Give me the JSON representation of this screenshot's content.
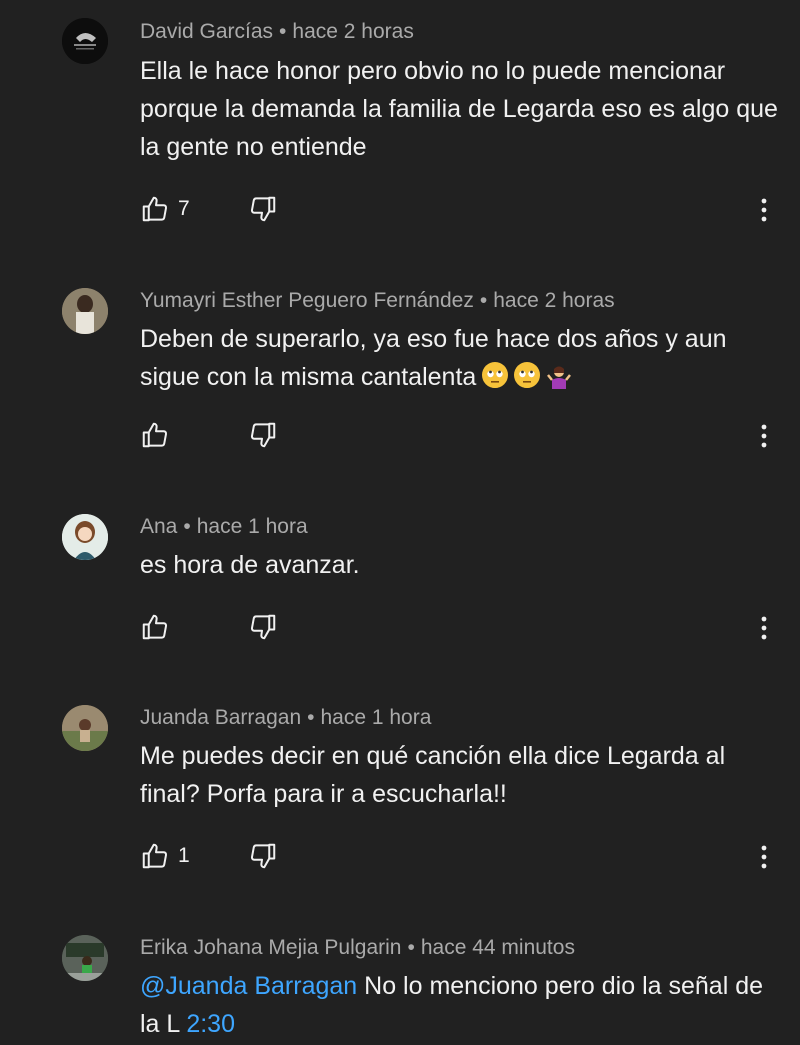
{
  "comments": [
    {
      "author": "David Garcías",
      "time": "hace 2 horas",
      "text": "Ella le hace honor pero obvio no lo puede mencionar porque la demanda la familia de Legarda eso es algo que la gente no entiende",
      "likes": "7",
      "avatar_color": "#111111"
    },
    {
      "author": "Yumayri Esther Peguero Fernández",
      "time": "hace 2 horas",
      "text": "Deben de superarlo, ya eso fue hace dos años y aun sigue con la misma cantalenta",
      "emojis": [
        "face-with-rolling-eyes",
        "face-with-rolling-eyes",
        "person-shrugging"
      ],
      "likes": "",
      "avatar_color": "#6b5c4a"
    },
    {
      "author": "Ana",
      "time": "hace 1 hora",
      "text": "es hora de avanzar.",
      "likes": "",
      "avatar_color": "#5d8a7a"
    },
    {
      "author": "Juanda Barragan",
      "time": "hace 1 hora",
      "text": "Me puedes decir en qué canción ella dice Legarda al final? Porfa para ir a escucharla!!",
      "likes": "1",
      "avatar_color": "#7a6a55"
    },
    {
      "author": "Erika Johana Mejia Pulgarin",
      "time": "hace 44 minutos",
      "mention": "@Juanda Barragan",
      "text": " No lo menciono pero dio la señal de la L ",
      "timestamp": "2:30",
      "avatar_color": "#4a5a4a"
    }
  ],
  "colors": {
    "background": "#212121",
    "meta": "#aaaaaa",
    "link": "#3ea6ff"
  }
}
